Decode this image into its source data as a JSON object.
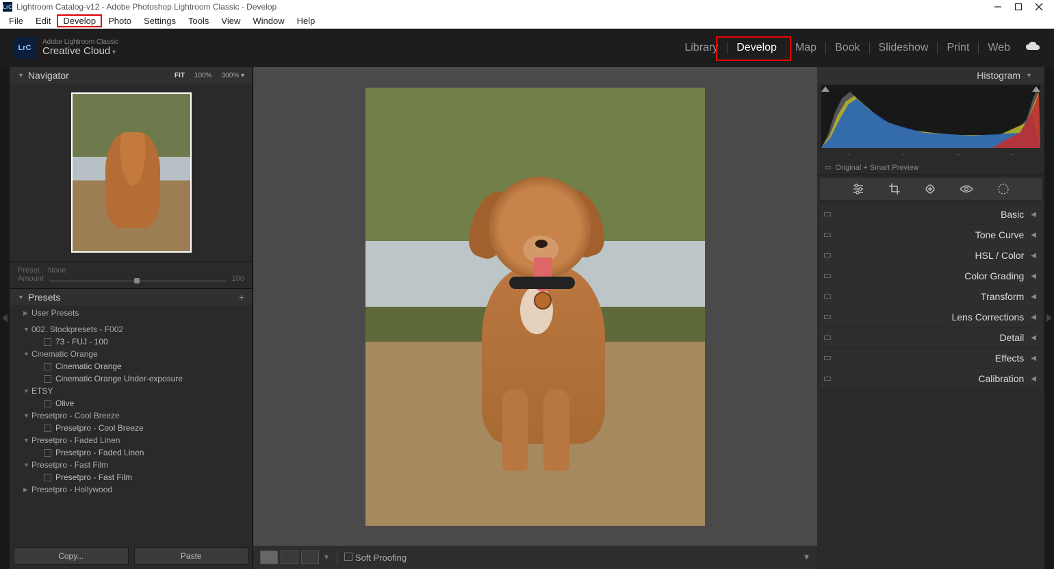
{
  "titlebar": {
    "app_icon": "LrC",
    "title": "Lightroom Catalog-v12 - Adobe Photoshop Lightroom Classic - Develop"
  },
  "menubar": [
    "File",
    "Edit",
    "Develop",
    "Photo",
    "Settings",
    "Tools",
    "View",
    "Window",
    "Help"
  ],
  "header": {
    "logo": "LrC",
    "brand_small": "Adobe Lightroom Classic",
    "brand": "Creative Cloud",
    "modules": [
      "Library",
      "Develop",
      "Map",
      "Book",
      "Slideshow",
      "Print",
      "Web"
    ],
    "active_module": "Develop"
  },
  "navigator": {
    "title": "Navigator",
    "zoom_levels": [
      "FIT",
      "100%",
      "300%  ▾"
    ]
  },
  "preset_bar": {
    "label_preset": "Preset :",
    "preset_value": "None",
    "label_amount": "Amount",
    "amount_value": "100"
  },
  "presets_panel": {
    "title": "Presets",
    "list": [
      {
        "type": "group_closed",
        "label": "User Presets"
      },
      {
        "type": "spacer"
      },
      {
        "type": "group_open",
        "label": "002. Stockpresets - F002"
      },
      {
        "type": "item",
        "label": "73 - FUJ - 100"
      },
      {
        "type": "group_open",
        "label": "Cinematic Orange"
      },
      {
        "type": "item",
        "label": "Cinematic Orange"
      },
      {
        "type": "item",
        "label": "Cinematic Orange Under-exposure"
      },
      {
        "type": "group_open",
        "label": "ETSY"
      },
      {
        "type": "item",
        "label": "Olive"
      },
      {
        "type": "group_open",
        "label": "Presetpro - Cool Breeze"
      },
      {
        "type": "item",
        "label": "Presetpro - Cool Breeze"
      },
      {
        "type": "group_open",
        "label": "Presetpro - Faded Linen"
      },
      {
        "type": "item",
        "label": "Presetpro - Faded Linen"
      },
      {
        "type": "group_open",
        "label": "Presetpro - Fast Film"
      },
      {
        "type": "item",
        "label": "Presetpro - Fast Film"
      },
      {
        "type": "group_closed",
        "label": "Presetpro - Hollywood"
      }
    ]
  },
  "left_buttons": {
    "copy": "Copy...",
    "paste": "Paste"
  },
  "center_toolbar": {
    "soft_proofing": "Soft Proofing"
  },
  "right": {
    "histogram_title": "Histogram",
    "smart_preview": "Original + Smart Preview",
    "sections": [
      "Basic",
      "Tone Curve",
      "HSL / Color",
      "Color Grading",
      "Transform",
      "Lens Corrections",
      "Detail",
      "Effects",
      "Calibration"
    ]
  }
}
